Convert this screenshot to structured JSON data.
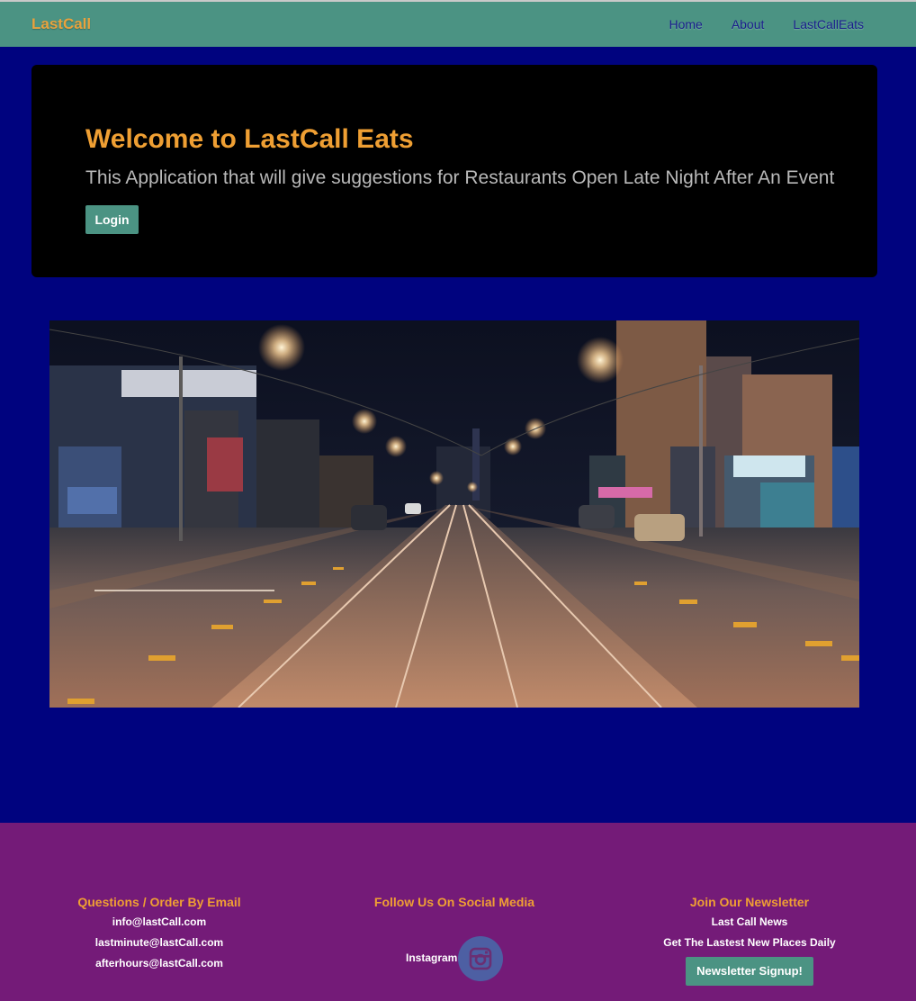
{
  "nav": {
    "brand": "LastCall",
    "links": [
      "Home",
      "About",
      "LastCallEats"
    ]
  },
  "jumbotron": {
    "title": "Welcome to LastCall Eats",
    "subtitle": "This Application that will give suggestions for Restaurants Open Late Night After An Event",
    "login_label": "Login"
  },
  "hero": {
    "image": "night-street-tram-tracks-photo"
  },
  "footer": {
    "email": {
      "heading": "Questions / Order By Email",
      "addresses": [
        "info@lastCall.com",
        "lastminute@lastCall.com",
        "afterhours@lastCall.com"
      ]
    },
    "social": {
      "heading": "Follow Us On Social Media",
      "instagram_label": "Instagram",
      "icon": "instagram-icon"
    },
    "newsletter": {
      "heading": "Join Our Newsletter",
      "line1": "Last Call News",
      "line2": "Get The Lastest New Places Daily",
      "button_label": "Newsletter Signup!"
    }
  },
  "colors": {
    "page_bg": "#00037f",
    "navbar": "#4b9383",
    "accent_orange": "#ef9f33",
    "footer_bg": "#741b78",
    "jumbotron_bg": "#000000",
    "social_circle": "#4d5fa3"
  }
}
